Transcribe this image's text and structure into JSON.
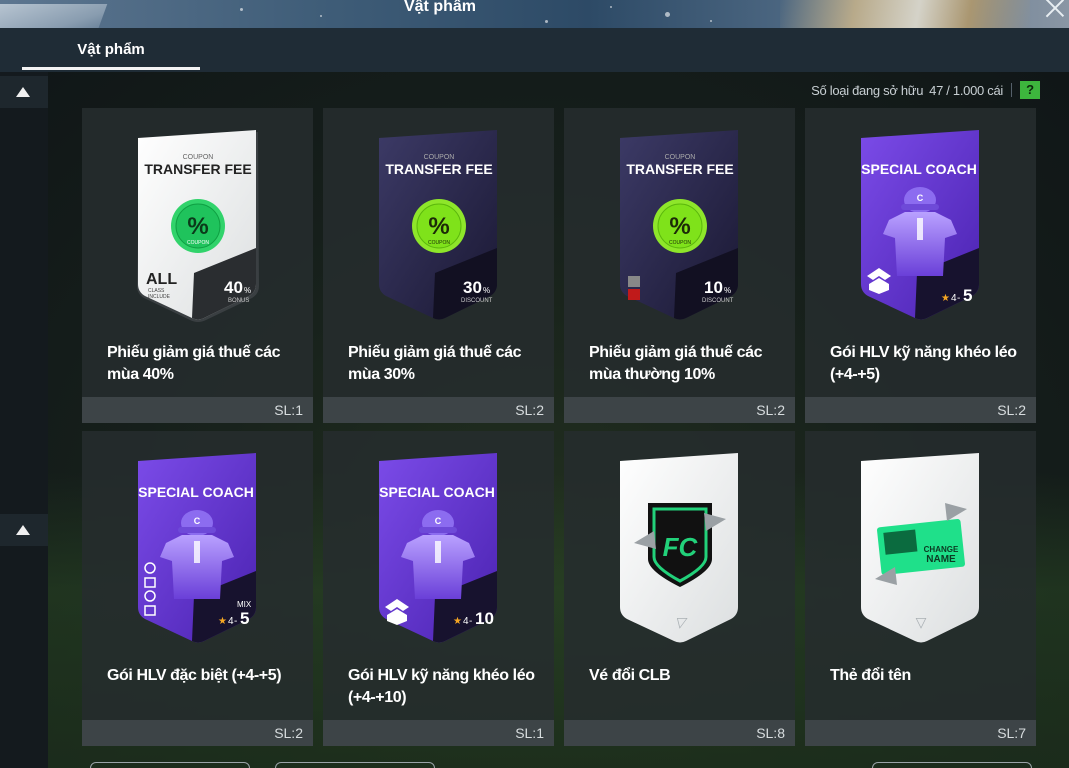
{
  "window": {
    "title": "Vật phẩm",
    "close_icon": "close-icon"
  },
  "tabs": [
    {
      "label": "Vật phẩm",
      "active": true
    }
  ],
  "inventory": {
    "owned_label": "Số loại đang sở hữu",
    "owned_count": "47 / 1.000 cái",
    "help_label": "?"
  },
  "items": [
    {
      "name": "Phiếu giảm giá thuế các mùa 40%",
      "qty": "SL:1",
      "art": {
        "header": "COUPON",
        "title": "TRANSFER FEE",
        "badge": "%",
        "badge_sub": "COUPON",
        "class_big": "ALL",
        "class_small1": "CLASS",
        "class_small2": "INCLUDE",
        "value": "40",
        "unit": "%",
        "value_label": "BONUS"
      }
    },
    {
      "name": "Phiếu giảm giá thuế các mùa 30%",
      "qty": "SL:2",
      "art": {
        "header": "COUPON",
        "title": "TRANSFER FEE",
        "badge": "%",
        "badge_sub": "COUPON",
        "value": "30",
        "unit": "%",
        "value_label": "DISCOUNT"
      }
    },
    {
      "name": "Phiếu giảm giá thuế các mùa thường 10%",
      "qty": "SL:2",
      "art": {
        "header": "COUPON",
        "title": "TRANSFER FEE",
        "badge": "%",
        "badge_sub": "COUPON",
        "value": "10",
        "unit": "%",
        "value_label": "DISCOUNT"
      }
    },
    {
      "name": "Gói HLV kỹ năng khéo léo (+4-+5)",
      "qty": "SL:2",
      "art": {
        "title": "SPECIAL COACH",
        "cap_letter": "C",
        "star": "★",
        "level_small": "4",
        "level_dash": "-",
        "level_big": "5"
      }
    },
    {
      "name": "Gói HLV đặc biệt (+4-+5)",
      "qty": "SL:2",
      "art": {
        "title": "SPECIAL COACH",
        "cap_letter": "C",
        "mix": "MIX",
        "star": "★",
        "level_small": "4",
        "level_dash": "-",
        "level_big": "5"
      }
    },
    {
      "name": "Gói HLV kỹ năng khéo léo (+4-+10)",
      "qty": "SL:1",
      "art": {
        "title": "SPECIAL COACH",
        "cap_letter": "C",
        "star": "★",
        "level_small": "4",
        "level_dash": "-",
        "level_big": "10"
      }
    },
    {
      "name": "Vé đổi CLB",
      "qty": "SL:8",
      "art": {
        "emblem_text": "FC"
      }
    },
    {
      "name": "Thẻ đổi tên",
      "qty": "SL:7",
      "art": {
        "line1": "CHANGE",
        "line2": "NAME"
      }
    }
  ],
  "colors": {
    "accent_green": "#3db63d",
    "coach_purple": "#6a3fd8",
    "coupon_green": "#7fe21a"
  }
}
